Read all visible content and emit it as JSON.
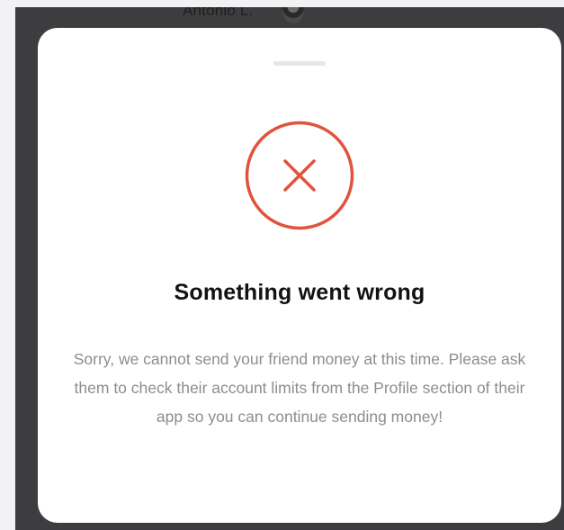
{
  "background": {
    "peek_name": "Antonio L."
  },
  "sheet": {
    "title": "Something went wrong",
    "message": "Sorry, we cannot send your friend money at this time. Please ask them to check their account limits from the Profile section of their app so you can continue sending money!",
    "icon": "error-x-circle-icon",
    "accent_color": "#e0533d"
  }
}
